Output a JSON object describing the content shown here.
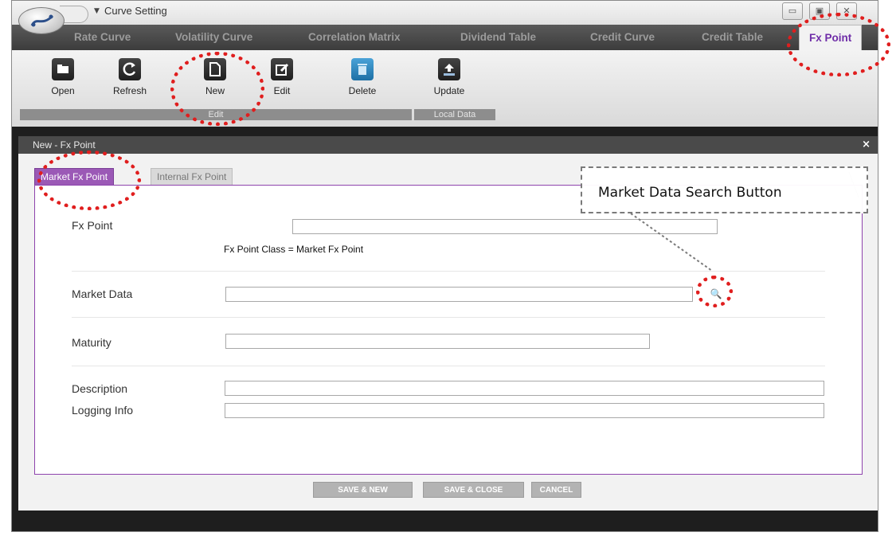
{
  "window": {
    "title": "Curve Setting"
  },
  "tabs": [
    {
      "label": "Rate Curve"
    },
    {
      "label": "Volatility Curve"
    },
    {
      "label": "Correlation Matrix"
    },
    {
      "label": "Dividend Table"
    },
    {
      "label": "Credit Curve"
    },
    {
      "label": "Credit Table"
    },
    {
      "label": "Fx Point",
      "active": true
    }
  ],
  "ribbon": {
    "buttons": [
      {
        "label": "Open",
        "icon": "folder-icon"
      },
      {
        "label": "Refresh",
        "icon": "refresh-icon"
      },
      {
        "label": "New",
        "icon": "new-document-icon"
      },
      {
        "label": "Edit",
        "icon": "edit-icon"
      },
      {
        "label": "Delete",
        "icon": "trash-icon"
      },
      {
        "label": "Update",
        "icon": "upload-icon"
      }
    ],
    "groups": [
      {
        "label": "Edit"
      },
      {
        "label": "Local Data"
      }
    ]
  },
  "dialog": {
    "title": "New - Fx Point",
    "close": "×",
    "tabs": [
      {
        "label": "Market Fx Point",
        "active": true
      },
      {
        "label": "Internal Fx Point"
      }
    ],
    "form": {
      "fx_point": {
        "label": "Fx Point",
        "value": ""
      },
      "fx_point_class": "Fx Point Class = Market Fx Point",
      "market_data": {
        "label": "Market Data",
        "value": ""
      },
      "maturity": {
        "label": "Maturity",
        "value": ""
      },
      "description": {
        "label": "Description",
        "value": ""
      },
      "logging_info": {
        "label": "Logging Info",
        "value": ""
      }
    },
    "buttons": {
      "save_new": "SAVE & NEW",
      "save_close": "SAVE & CLOSE",
      "cancel": "CANCEL"
    }
  },
  "annotation": {
    "callout": "Market Data Search Button"
  },
  "colors": {
    "accent": "#9b59b6",
    "highlight": "#e01e1e",
    "tabbar": "#3c3c3c",
    "active_tab_text": "#6f2da8"
  }
}
